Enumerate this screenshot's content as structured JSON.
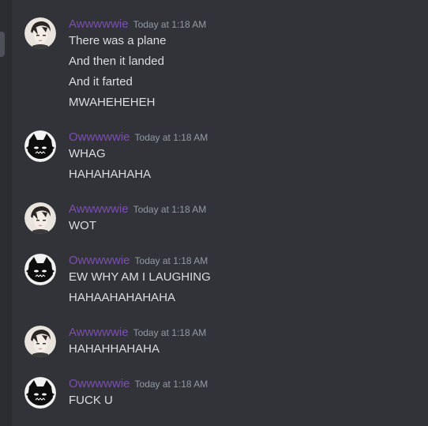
{
  "colors": {
    "background": "#313338",
    "username": "#7c4fb0",
    "message_text": "#dbdee1",
    "timestamp": "#949ba4"
  },
  "messages": [
    {
      "author": "Awwwwwie",
      "avatar": "anime-boy-avatar",
      "timestamp": "Today at 1:18 AM",
      "lines": [
        "There was a plane",
        "And then it landed",
        "And it farted",
        "MWAHEHEHEH"
      ]
    },
    {
      "author": "Owwwwwie",
      "avatar": "black-creature-avatar",
      "timestamp": "Today at 1:18 AM",
      "lines": [
        "WHAG",
        "HAHAHAHAHA"
      ]
    },
    {
      "author": "Awwwwwie",
      "avatar": "anime-boy-avatar",
      "timestamp": "Today at 1:18 AM",
      "lines": [
        "WOT"
      ]
    },
    {
      "author": "Owwwwwie",
      "avatar": "black-creature-avatar",
      "timestamp": "Today at 1:18 AM",
      "lines": [
        "EW WHY AM I LAUGHING",
        "HAHAAHAHAHAHA"
      ]
    },
    {
      "author": "Awwwwwie",
      "avatar": "anime-boy-avatar",
      "timestamp": "Today at 1:18 AM",
      "lines": [
        "HAHAHHAHAHA"
      ]
    },
    {
      "author": "Owwwwwie",
      "avatar": "black-creature-avatar",
      "timestamp": "Today at 1:18 AM",
      "lines": [
        "FUCK U"
      ]
    }
  ]
}
